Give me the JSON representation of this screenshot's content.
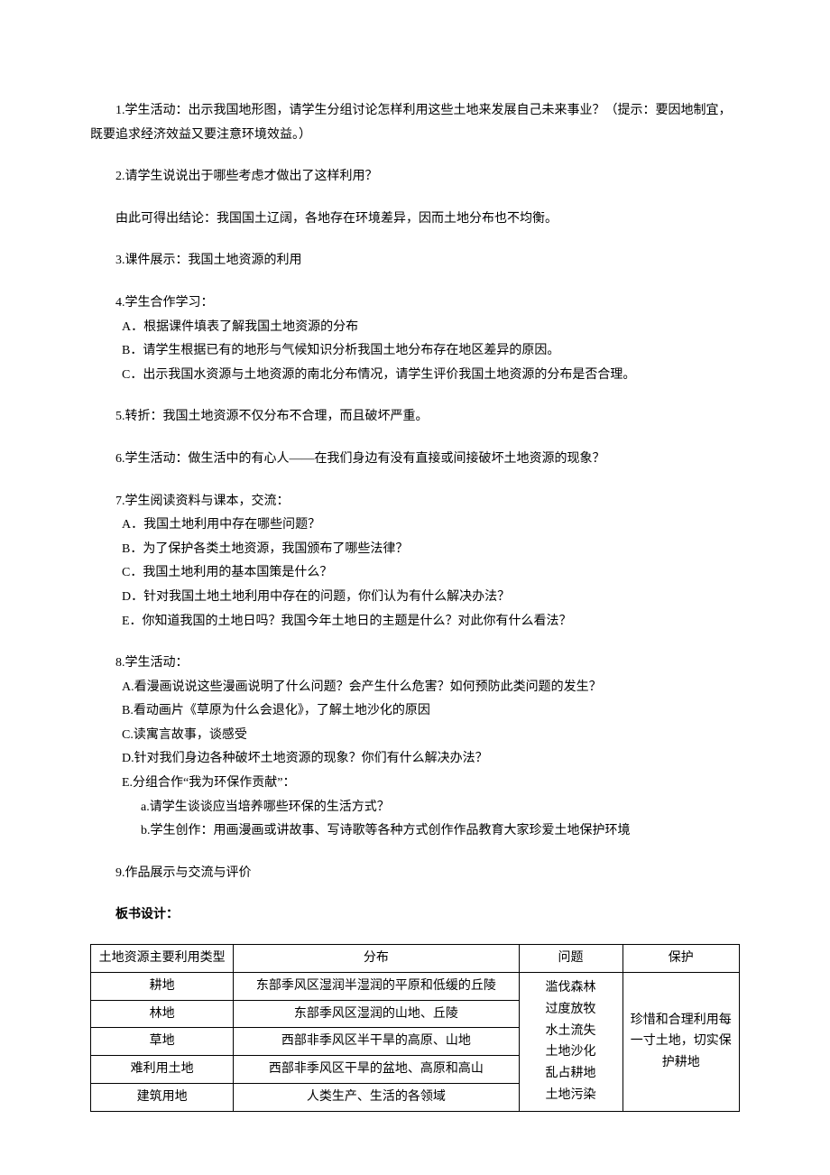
{
  "p1": "1.学生活动：出示我国地形图，请学生分组讨论怎样利用这些土地来发展自己未来事业？（提示：要因地制宜，既要追求经济效益又要注意环境效益。）",
  "p2": "2.请学生说说出于哪些考虑才做出了这样利用？",
  "p2b": "由此可得出结论：我国国土辽阔，各地存在环境差异，因而土地分布也不均衡。",
  "p3": "3.课件展示：我国土地资源的利用",
  "p4": "4.学生合作学习：",
  "p4a": "A．根据课件填表了解我国土地资源的分布",
  "p4b": "B．请学生根据已有的地形与气候知识分析我国土地分布存在地区差异的原因。",
  "p4c": "C．出示我国水资源与土地资源的南北分布情况，请学生评价我国土地资源的分布是否合理。",
  "p5": "5.转折：我国土地资源不仅分布不合理，而且破坏严重。",
  "p6": "6.学生活动：做生活中的有心人——在我们身边有没有直接或间接破坏土地资源的现象？",
  "p7": "7.学生阅读资料与课本，交流：",
  "p7a": "A．我国土地利用中存在哪些问题？",
  "p7b": "B．为了保护各类土地资源，我国颁布了哪些法律？",
  "p7c": "C．我国土地利用的基本国策是什么？",
  "p7d": "D．针对我国土地土地利用中存在的问题，你们认为有什么解决办法？",
  "p7e": "E．你知道我国的土地日吗？我国今年土地日的主题是什么？对此你有什么看法？",
  "p8": "8.学生活动：",
  "p8a": "A.看漫画说说这些漫画说明了什么问题？会产生什么危害？如何预防此类问题的发生？",
  "p8b": "B.看动画片《草原为什么会退化》，了解土地沙化的原因",
  "p8c": "C.读寓言故事，谈感受",
  "p8d": "D.针对我们身边各种破坏土地资源的现象？你们有什么解决办法？",
  "p8e": "E.分组合作“我为环保作贡献”：",
  "p8ea": "a.请学生谈谈应当培养哪些环保的生活方式？",
  "p8eb": "b.学生创作：用画漫画或讲故事、写诗歌等各种方式创作作品教育大家珍爱土地保护环境",
  "p9": "9.作品展示与交流与评价",
  "board_title": "板书设计：",
  "table": {
    "headers": {
      "col1": "土地资源主要利用类型",
      "col2": "分布",
      "col3": "问题",
      "col4": "保护"
    },
    "rows": [
      {
        "type": "耕地",
        "dist": "东部季风区湿润半湿润的平原和低缓的丘陵"
      },
      {
        "type": "林地",
        "dist": "东部季风区湿润的山地、丘陵"
      },
      {
        "type": "草地",
        "dist": "西部非季风区半干旱的高原、山地"
      },
      {
        "type": "难利用土地",
        "dist": "西部非季风区干旱的盆地、高原和高山"
      },
      {
        "type": "建筑用地",
        "dist": "人类生产、生活的各领域"
      }
    ],
    "problems": "滥伐森林\n过度放牧\n水土流失\n土地沙化\n乱占耕地\n土地污染",
    "protection": "珍惜和合理利用每一寸土地，切实保护耕地"
  }
}
